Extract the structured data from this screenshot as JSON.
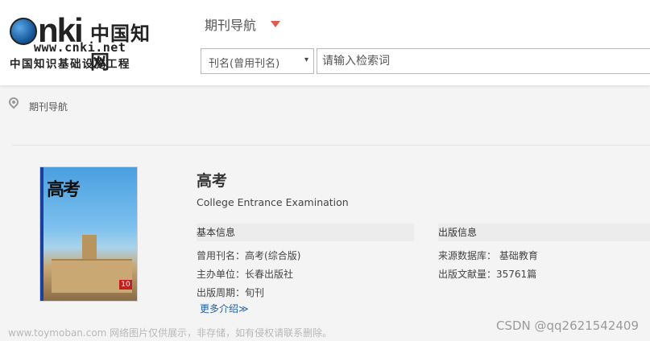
{
  "logo": {
    "cnki_text": "nki",
    "chinese_name": "中国知网",
    "url": "www.cnki.net",
    "subtitle": "中国知识基础设施工程"
  },
  "nav": {
    "title": "期刊导航"
  },
  "search": {
    "field_selected": "刊名(曾用刊名)",
    "dropdown_arrow": "▾",
    "placeholder": "请输入检索词"
  },
  "breadcrumb": {
    "icon": "location-pin-icon",
    "text": "期刊导航"
  },
  "journal": {
    "cover_title": "高考",
    "cover_issue": "10",
    "title": "高考",
    "english_title": "College Entrance Examination",
    "basic_info": {
      "heading": "基本信息",
      "former_name_label": "曾用刊名：",
      "former_name_value": "高考(综合版)",
      "sponsor_label": "主办单位：",
      "sponsor_value": "长春出版社",
      "cycle_label": "出版周期：",
      "cycle_value": "旬刊"
    },
    "publication_info": {
      "heading": "出版信息",
      "database_label": "来源数据库：",
      "database_value": "基础教育",
      "count_label": "出版文献量：",
      "count_value": "35761篇"
    },
    "more_link": "更多介绍≫"
  },
  "overlays": {
    "watermark": "www.toymoban.com 网络图片仅供展示，非存储，如有侵权请联系删除。",
    "csdn": "CSDN @qq2621542409"
  },
  "colors": {
    "caret": "#e05a4e",
    "link": "#1f5fa8",
    "cover_strip": "#1b3f9d"
  }
}
